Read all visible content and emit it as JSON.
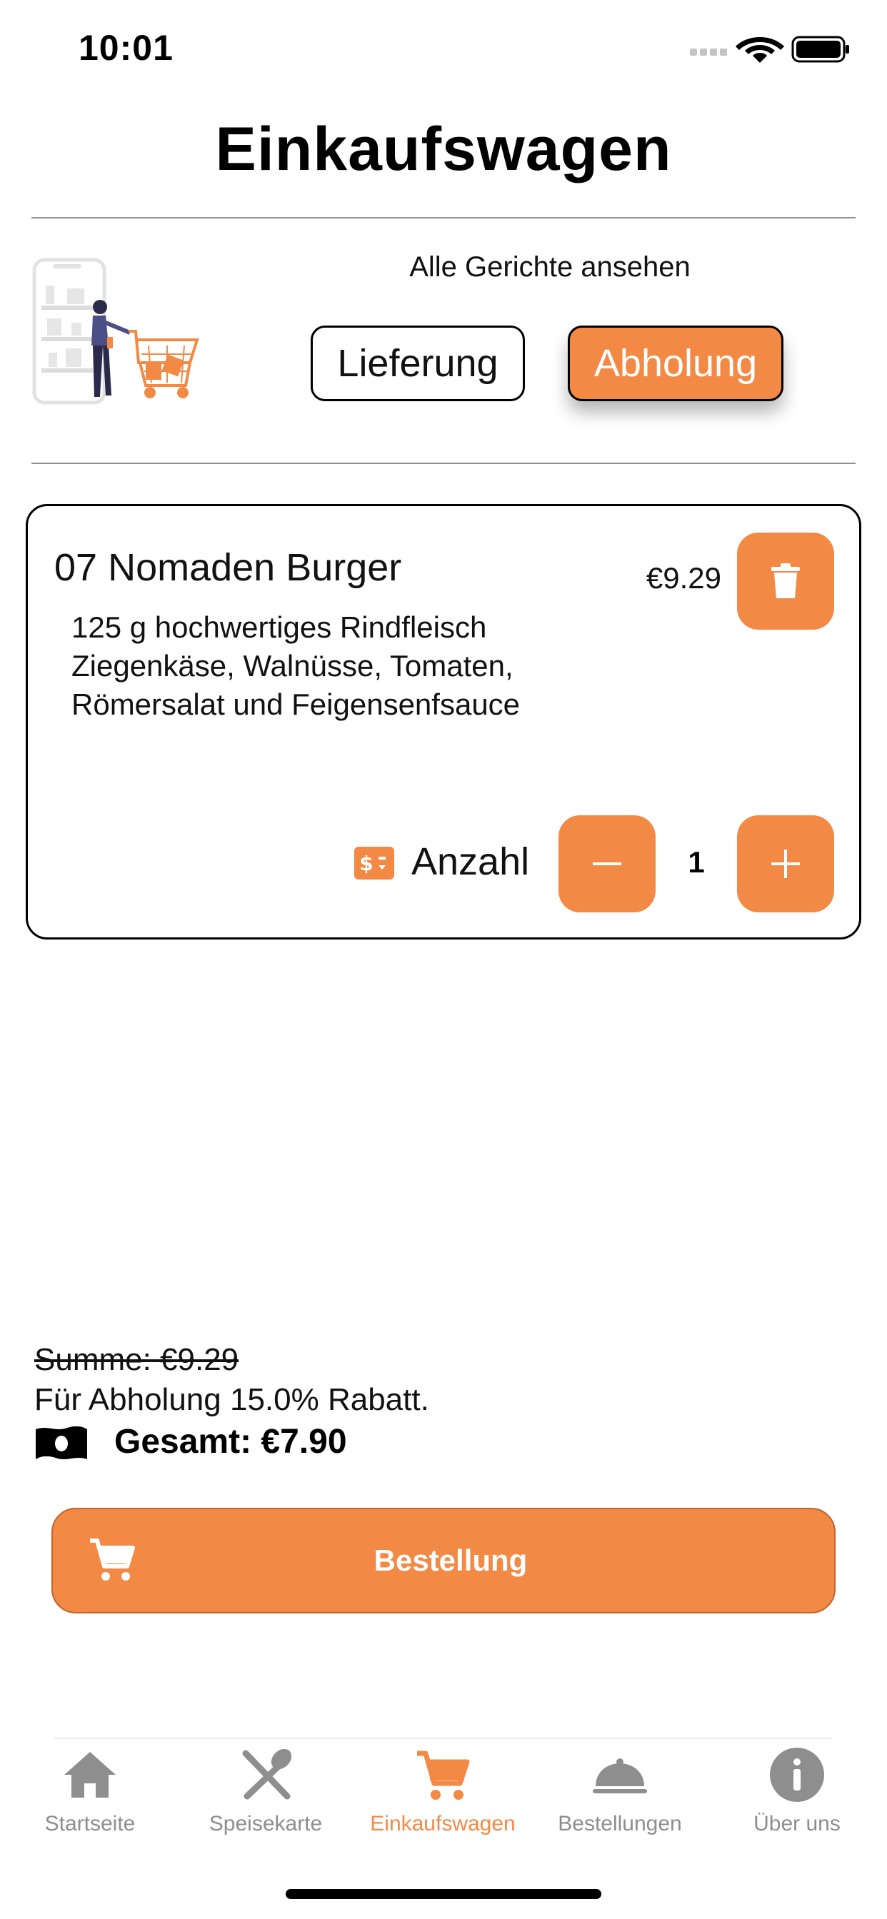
{
  "status_bar": {
    "time": "10:01"
  },
  "header": {
    "title": "Einkaufswagen"
  },
  "mode": {
    "see_all_label": "Alle Gerichte ansehen",
    "delivery_label": "Lieferung",
    "pickup_label": "Abholung",
    "selected": "Abholung"
  },
  "cart_item": {
    "name": "07 Nomaden Burger",
    "price": "€9.29",
    "description_lines": [
      "125 g hochwertiges Rindfleisch",
      "Ziegenkäse, Walnüsse, Tomaten,",
      "Römersalat und Feigensenfsauce"
    ],
    "quantity_label": "Anzahl",
    "quantity": "1"
  },
  "summary": {
    "sum": "Summe: €9.29",
    "discount": "Für Abholung 15.0% Rabatt.",
    "total": "Gesamt: €7.90"
  },
  "order_button": {
    "label": "Bestellung"
  },
  "tabs": [
    {
      "label": "Startseite",
      "icon": "home-icon"
    },
    {
      "label": "Speisekarte",
      "icon": "utensils-icon"
    },
    {
      "label": "Einkaufswagen",
      "icon": "cart-icon",
      "active": true
    },
    {
      "label": "Bestellungen",
      "icon": "cloche-icon"
    },
    {
      "label": "Über uns",
      "icon": "info-icon"
    }
  ],
  "colors": {
    "accent": "#F28A45",
    "inactive": "#8E8E8E"
  }
}
